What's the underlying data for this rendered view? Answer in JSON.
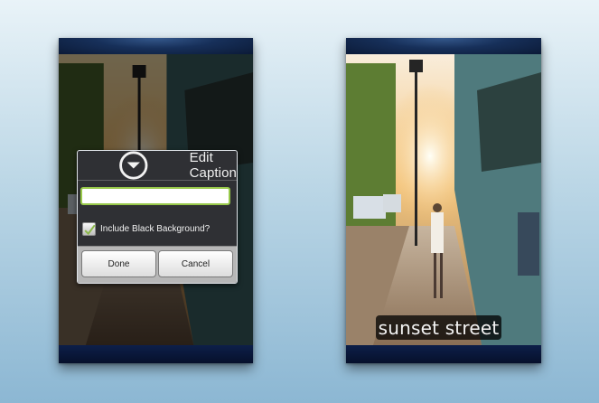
{
  "left_screen": {
    "dialog": {
      "title": "Edit Caption",
      "caption_value": "",
      "checkbox_label": "Include Black Background?",
      "checkbox_checked": true,
      "done_label": "Done",
      "cancel_label": "Cancel"
    }
  },
  "right_screen": {
    "caption_text": "sunset street"
  },
  "icons": {
    "dialog_icon": "circle-chevron-down-icon",
    "checkbox_mark": "check-icon"
  },
  "colors": {
    "background_top": "#e9f3f8",
    "background_bottom": "#8cb7d3",
    "status_bar": "#17305a",
    "input_border": "#98c94a",
    "dialog_bg": "#2f3034"
  }
}
